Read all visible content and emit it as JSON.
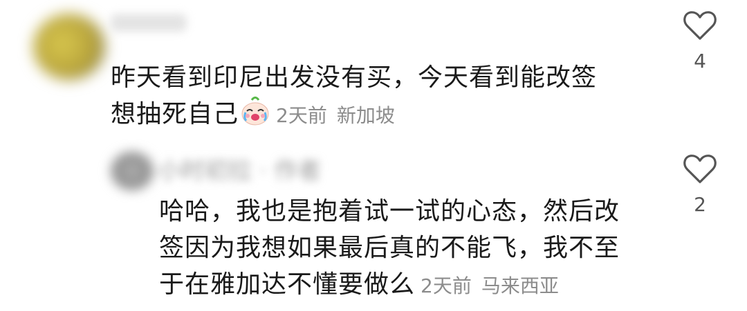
{
  "comments": [
    {
      "text_line1": "昨天看到印尼出发没有买，今天看到能改签",
      "text_line2": "想抽死自己",
      "emoji": "laughing-crying-emoji",
      "time": "2天前",
      "location": "新加坡",
      "likes": "4",
      "avatar_color": "#c9b84a"
    },
    {
      "username_blurred": "小时初拉 · 作者",
      "text_line1": "哈哈，我也是抱着试一试的心态，然后改",
      "text_line2": "签因为我想如果最后真的不能飞，我不至",
      "text_line3": "于在雅加达不懂要做么",
      "time": "2天前",
      "location": "马来西亚",
      "likes": "2",
      "avatar_color": "#9a9a9a"
    }
  ],
  "colors": {
    "text": "#1a1a1a",
    "meta": "#8c8c8c",
    "icon": "#555555"
  }
}
